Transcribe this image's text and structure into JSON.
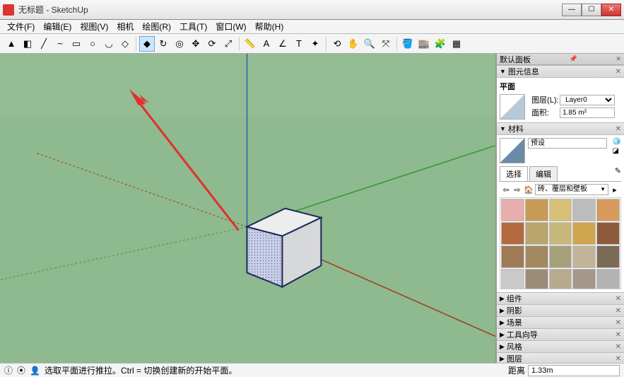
{
  "title": "无标题 - SketchUp",
  "menu": [
    "文件(F)",
    "编辑(E)",
    "视图(V)",
    "相机",
    "绘图(R)",
    "工具(T)",
    "窗口(W)",
    "帮助(H)"
  ],
  "toolbar_names": [
    "select-tool",
    "eraser-tool",
    "line-tool",
    "freehand-tool",
    "rectangle-tool",
    "circle-tool",
    "arc-tool",
    "polygon-tool",
    "sep",
    "push-pull-tool",
    "follow-me-tool",
    "offset-tool",
    "move-tool",
    "rotate-tool",
    "scale-tool",
    "sep",
    "tape-measure-tool",
    "dimension-tool",
    "protractor-tool",
    "text-tool",
    "axes-tool",
    "sep",
    "orbit-tool",
    "pan-tool",
    "zoom-tool",
    "zoom-extents-tool",
    "sep",
    "paint-bucket-tool",
    "3d-warehouse-tool",
    "extension-warehouse-tool",
    "layers-tool"
  ],
  "toolbar_glyphs": [
    "▲",
    "◧",
    "╱",
    "~",
    "▭",
    "○",
    "◡",
    "◇",
    "",
    "◆",
    "↻",
    "◎",
    "✥",
    "⟳",
    "⤢",
    "",
    "📏",
    "A",
    "∠",
    "T",
    "✦",
    "",
    "⟲",
    "✋",
    "🔍",
    "⤧",
    "",
    "🪣",
    "🏬",
    "🧩",
    "▦"
  ],
  "status_hint": "选取平面进行推拉。Ctrl = 切换创建新的开始平面。",
  "distance_label": "距离",
  "distance_value": "1.33m",
  "tray_title": "默认面板",
  "panels": {
    "entity": {
      "title": "图元信息",
      "subtitle": "平面",
      "layer_label": "图层(L):",
      "layer_value": "Layer0",
      "area_label": "面积:",
      "area_value": "1.85 m²"
    },
    "materials": {
      "title": "材料",
      "name": "预设",
      "tab_select": "选择",
      "tab_edit": "编辑",
      "category": "砖、覆层和壁板"
    },
    "collapsed": [
      "组件",
      "阴影",
      "场景",
      "工具向导",
      "风格",
      "图层"
    ]
  },
  "swatch_colors": [
    "#e8adac",
    "#c79a55",
    "#d7c178",
    "#bdbdbd",
    "#d89a5a",
    "#b36a3f",
    "#b9a56d",
    "#c8b77a",
    "#d1a54f",
    "#8d5a3b",
    "#9e7b57",
    "#a28a60",
    "#a6a07a",
    "#c2b49a",
    "#7a6a56",
    "#c9c9c9",
    "#9b8c77",
    "#b7ab8e",
    "#a59888",
    "#b3b3b3"
  ]
}
